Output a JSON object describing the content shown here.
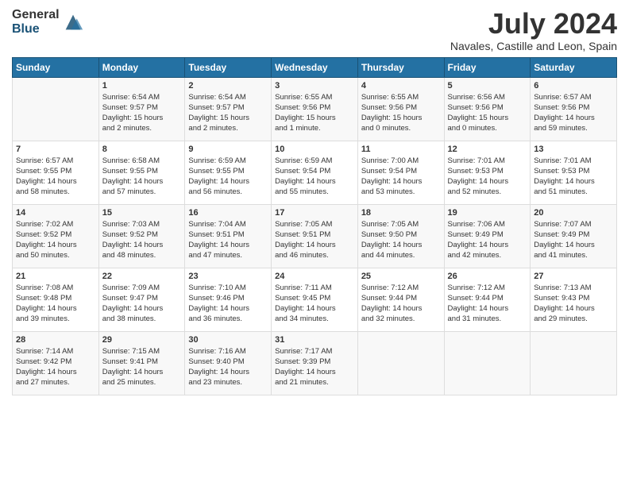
{
  "header": {
    "logo_general": "General",
    "logo_blue": "Blue",
    "title": "July 2024",
    "location": "Navales, Castille and Leon, Spain"
  },
  "days_of_week": [
    "Sunday",
    "Monday",
    "Tuesday",
    "Wednesday",
    "Thursday",
    "Friday",
    "Saturday"
  ],
  "weeks": [
    [
      {
        "day": "",
        "info": ""
      },
      {
        "day": "1",
        "info": "Sunrise: 6:54 AM\nSunset: 9:57 PM\nDaylight: 15 hours\nand 2 minutes."
      },
      {
        "day": "2",
        "info": "Sunrise: 6:54 AM\nSunset: 9:57 PM\nDaylight: 15 hours\nand 2 minutes."
      },
      {
        "day": "3",
        "info": "Sunrise: 6:55 AM\nSunset: 9:56 PM\nDaylight: 15 hours\nand 1 minute."
      },
      {
        "day": "4",
        "info": "Sunrise: 6:55 AM\nSunset: 9:56 PM\nDaylight: 15 hours\nand 0 minutes."
      },
      {
        "day": "5",
        "info": "Sunrise: 6:56 AM\nSunset: 9:56 PM\nDaylight: 15 hours\nand 0 minutes."
      },
      {
        "day": "6",
        "info": "Sunrise: 6:57 AM\nSunset: 9:56 PM\nDaylight: 14 hours\nand 59 minutes."
      }
    ],
    [
      {
        "day": "7",
        "info": "Sunrise: 6:57 AM\nSunset: 9:55 PM\nDaylight: 14 hours\nand 58 minutes."
      },
      {
        "day": "8",
        "info": "Sunrise: 6:58 AM\nSunset: 9:55 PM\nDaylight: 14 hours\nand 57 minutes."
      },
      {
        "day": "9",
        "info": "Sunrise: 6:59 AM\nSunset: 9:55 PM\nDaylight: 14 hours\nand 56 minutes."
      },
      {
        "day": "10",
        "info": "Sunrise: 6:59 AM\nSunset: 9:54 PM\nDaylight: 14 hours\nand 55 minutes."
      },
      {
        "day": "11",
        "info": "Sunrise: 7:00 AM\nSunset: 9:54 PM\nDaylight: 14 hours\nand 53 minutes."
      },
      {
        "day": "12",
        "info": "Sunrise: 7:01 AM\nSunset: 9:53 PM\nDaylight: 14 hours\nand 52 minutes."
      },
      {
        "day": "13",
        "info": "Sunrise: 7:01 AM\nSunset: 9:53 PM\nDaylight: 14 hours\nand 51 minutes."
      }
    ],
    [
      {
        "day": "14",
        "info": "Sunrise: 7:02 AM\nSunset: 9:52 PM\nDaylight: 14 hours\nand 50 minutes."
      },
      {
        "day": "15",
        "info": "Sunrise: 7:03 AM\nSunset: 9:52 PM\nDaylight: 14 hours\nand 48 minutes."
      },
      {
        "day": "16",
        "info": "Sunrise: 7:04 AM\nSunset: 9:51 PM\nDaylight: 14 hours\nand 47 minutes."
      },
      {
        "day": "17",
        "info": "Sunrise: 7:05 AM\nSunset: 9:51 PM\nDaylight: 14 hours\nand 46 minutes."
      },
      {
        "day": "18",
        "info": "Sunrise: 7:05 AM\nSunset: 9:50 PM\nDaylight: 14 hours\nand 44 minutes."
      },
      {
        "day": "19",
        "info": "Sunrise: 7:06 AM\nSunset: 9:49 PM\nDaylight: 14 hours\nand 42 minutes."
      },
      {
        "day": "20",
        "info": "Sunrise: 7:07 AM\nSunset: 9:49 PM\nDaylight: 14 hours\nand 41 minutes."
      }
    ],
    [
      {
        "day": "21",
        "info": "Sunrise: 7:08 AM\nSunset: 9:48 PM\nDaylight: 14 hours\nand 39 minutes."
      },
      {
        "day": "22",
        "info": "Sunrise: 7:09 AM\nSunset: 9:47 PM\nDaylight: 14 hours\nand 38 minutes."
      },
      {
        "day": "23",
        "info": "Sunrise: 7:10 AM\nSunset: 9:46 PM\nDaylight: 14 hours\nand 36 minutes."
      },
      {
        "day": "24",
        "info": "Sunrise: 7:11 AM\nSunset: 9:45 PM\nDaylight: 14 hours\nand 34 minutes."
      },
      {
        "day": "25",
        "info": "Sunrise: 7:12 AM\nSunset: 9:44 PM\nDaylight: 14 hours\nand 32 minutes."
      },
      {
        "day": "26",
        "info": "Sunrise: 7:12 AM\nSunset: 9:44 PM\nDaylight: 14 hours\nand 31 minutes."
      },
      {
        "day": "27",
        "info": "Sunrise: 7:13 AM\nSunset: 9:43 PM\nDaylight: 14 hours\nand 29 minutes."
      }
    ],
    [
      {
        "day": "28",
        "info": "Sunrise: 7:14 AM\nSunset: 9:42 PM\nDaylight: 14 hours\nand 27 minutes."
      },
      {
        "day": "29",
        "info": "Sunrise: 7:15 AM\nSunset: 9:41 PM\nDaylight: 14 hours\nand 25 minutes."
      },
      {
        "day": "30",
        "info": "Sunrise: 7:16 AM\nSunset: 9:40 PM\nDaylight: 14 hours\nand 23 minutes."
      },
      {
        "day": "31",
        "info": "Sunrise: 7:17 AM\nSunset: 9:39 PM\nDaylight: 14 hours\nand 21 minutes."
      },
      {
        "day": "",
        "info": ""
      },
      {
        "day": "",
        "info": ""
      },
      {
        "day": "",
        "info": ""
      }
    ]
  ]
}
